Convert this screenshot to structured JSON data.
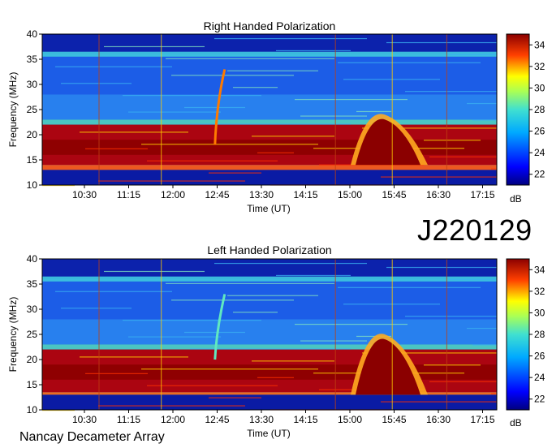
{
  "observation_id": "J220129",
  "instrument_label": "Nancay Decameter Array",
  "colorbar_unit": "dB",
  "colors": {
    "low": "#00008b",
    "mid_low": "#1e90ff",
    "mid": "#40e0d0",
    "mid_high": "#ffff00",
    "high": "#ff4500",
    "max": "#8b0000"
  },
  "chart_data": [
    {
      "type": "heatmap",
      "title": "Right Handed Polarization",
      "xlabel": "Time (UT)",
      "ylabel": "Frequency (MHz)",
      "x_ticks": [
        "10:30",
        "11:15",
        "12:00",
        "12:45",
        "13:30",
        "14:15",
        "15:00",
        "15:45",
        "16:30",
        "17:15"
      ],
      "y_ticks": [
        10,
        15,
        20,
        25,
        30,
        35,
        40
      ],
      "ylim": [
        10,
        40
      ],
      "colorbar_ticks": [
        22,
        24,
        26,
        28,
        30,
        32,
        34
      ],
      "colorbar_range": [
        21,
        35
      ],
      "features": [
        {
          "name": "strong emission band",
          "freq_range": [
            14,
            22
          ],
          "level_db": 34
        },
        {
          "name": "burst",
          "time": "15:15",
          "freq_range": [
            14,
            24
          ],
          "level_db": 35
        },
        {
          "name": "drifting arc",
          "time": "12:45",
          "freq_range": [
            18,
            33
          ],
          "level_db": 32
        }
      ]
    },
    {
      "type": "heatmap",
      "title": "Left Handed Polarization",
      "xlabel": "Time (UT)",
      "ylabel": "Frequency (MHz)",
      "x_ticks": [
        "10:30",
        "11:15",
        "12:00",
        "12:45",
        "13:30",
        "14:15",
        "15:00",
        "15:45",
        "16:30",
        "17:15"
      ],
      "y_ticks": [
        10,
        15,
        20,
        25,
        30,
        35,
        40
      ],
      "ylim": [
        10,
        40
      ],
      "colorbar_ticks": [
        22,
        24,
        26,
        28,
        30,
        32,
        34
      ],
      "colorbar_range": [
        21,
        35
      ],
      "features": [
        {
          "name": "strong emission band",
          "freq_range": [
            13,
            22
          ],
          "level_db": 34
        },
        {
          "name": "burst",
          "time": "15:20",
          "freq_range": [
            13,
            25
          ],
          "level_db": 35
        },
        {
          "name": "drifting arc",
          "time": "12:45",
          "freq_range": [
            20,
            33
          ],
          "level_db": 30
        }
      ]
    }
  ]
}
